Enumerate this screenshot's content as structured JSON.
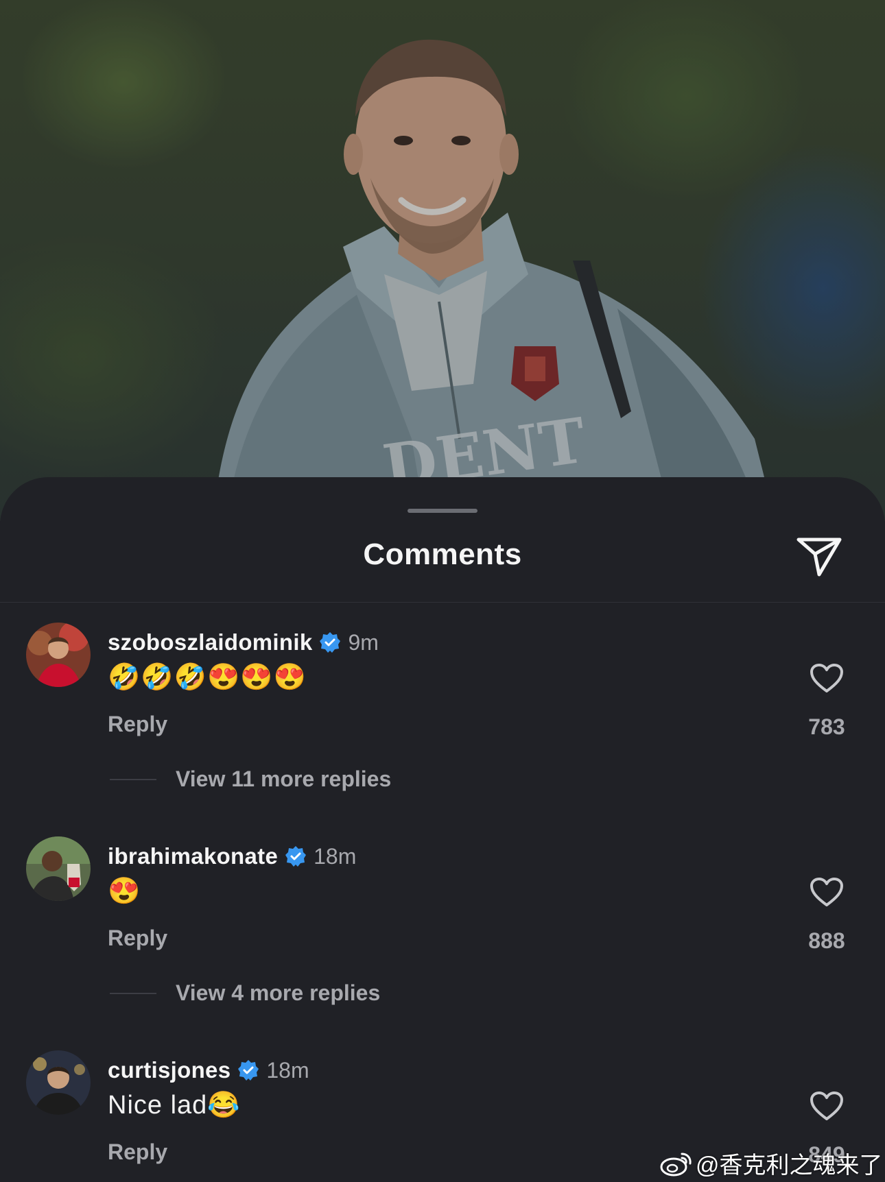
{
  "sheet": {
    "title": "Comments",
    "share_icon": "paper-plane-icon"
  },
  "comments": [
    {
      "username": "szoboszlaidominik",
      "verified": true,
      "time": "9m",
      "text": "🤣🤣🤣😍😍😍",
      "reply_label": "Reply",
      "likes": "783",
      "view_replies": "View 11 more replies"
    },
    {
      "username": "ibrahimakonate",
      "verified": true,
      "time": "18m",
      "text": "😍",
      "reply_label": "Reply",
      "likes": "888",
      "view_replies": "View 4 more replies"
    },
    {
      "username": "curtisjones",
      "verified": true,
      "time": "18m",
      "text": "Nice lad😂",
      "reply_label": "Reply",
      "likes": "849"
    }
  ],
  "watermark": {
    "text": "@香克利之魂来了"
  },
  "colors": {
    "sheet_bg": "#202126",
    "verified_blue": "#3897f0",
    "secondary_text": "#a8a9ae"
  }
}
